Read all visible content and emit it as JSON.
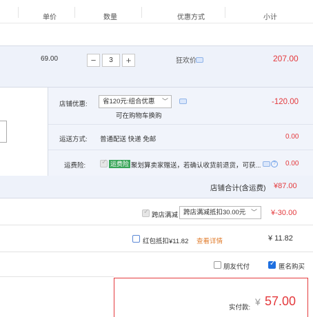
{
  "header": {
    "unit_price": "单价",
    "quantity": "数量",
    "offer": "优惠方式",
    "subtotal": "小计"
  },
  "item": {
    "price": "69.00",
    "quantity": "3",
    "minus": "−",
    "plus": "+",
    "offer_label": "狂欢价",
    "amount": "207.00"
  },
  "shop_promo": {
    "label": "店铺优惠:",
    "selected": "省120元:组合优惠",
    "note": "可在购物车换购",
    "amount": "-120.00"
  },
  "shipping": {
    "label": "运送方式:",
    "value": "普通配送 快递 免邮",
    "amount": "0.00"
  },
  "insurance": {
    "label": "运费险:",
    "tag": "运费险",
    "text": "聚划算卖家赠送，若确认收货前退货，可获...",
    "amount": "0.00"
  },
  "shop_total": {
    "label": "店铺合计(含运费)",
    "amount": "¥87.00"
  },
  "cross_store": {
    "label": "跨店满减",
    "selected": "跨店满减抵扣30.00元",
    "amount": "¥-30.00"
  },
  "red_packet": {
    "label": "红包抵扣¥11.82",
    "link": "查看详情",
    "amount": "¥ 11.82"
  },
  "options": {
    "friend_pay": "朋友代付",
    "anonymous": "匿名购买"
  },
  "payment": {
    "label": "实付款:",
    "currency": "¥",
    "amount": "57.00"
  },
  "colors": {
    "accent_red": "#e4393c",
    "link_orange": "#e07c2c",
    "checkbox_blue": "#1e6fe0",
    "row_bg": "#eef2fa"
  }
}
